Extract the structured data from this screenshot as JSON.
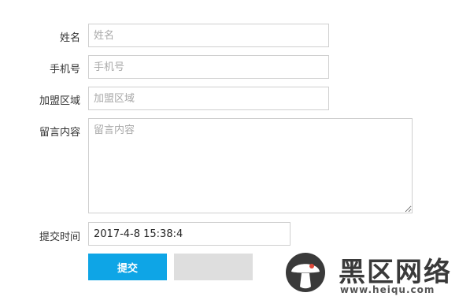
{
  "form": {
    "name": {
      "label": "姓名",
      "placeholder": "姓名",
      "value": ""
    },
    "phone": {
      "label": "手机号",
      "placeholder": "手机号",
      "value": ""
    },
    "region": {
      "label": "加盟区域",
      "placeholder": "加盟区域",
      "value": ""
    },
    "message": {
      "label": "留言内容",
      "placeholder": "留言内容",
      "value": ""
    },
    "submit_time": {
      "label": "提交时间",
      "value": "2017-4-8 15:38:4"
    },
    "submit_button_label": "提交"
  },
  "watermark": {
    "title": "黑区网络",
    "url": "www.heiqu.com",
    "logo_icon": "mushroom-logo-icon"
  },
  "colors": {
    "accent": "#0ea5e6",
    "border": "#cfcfcf",
    "secondary_button": "#dedede",
    "logo_red": "#e0493a"
  }
}
